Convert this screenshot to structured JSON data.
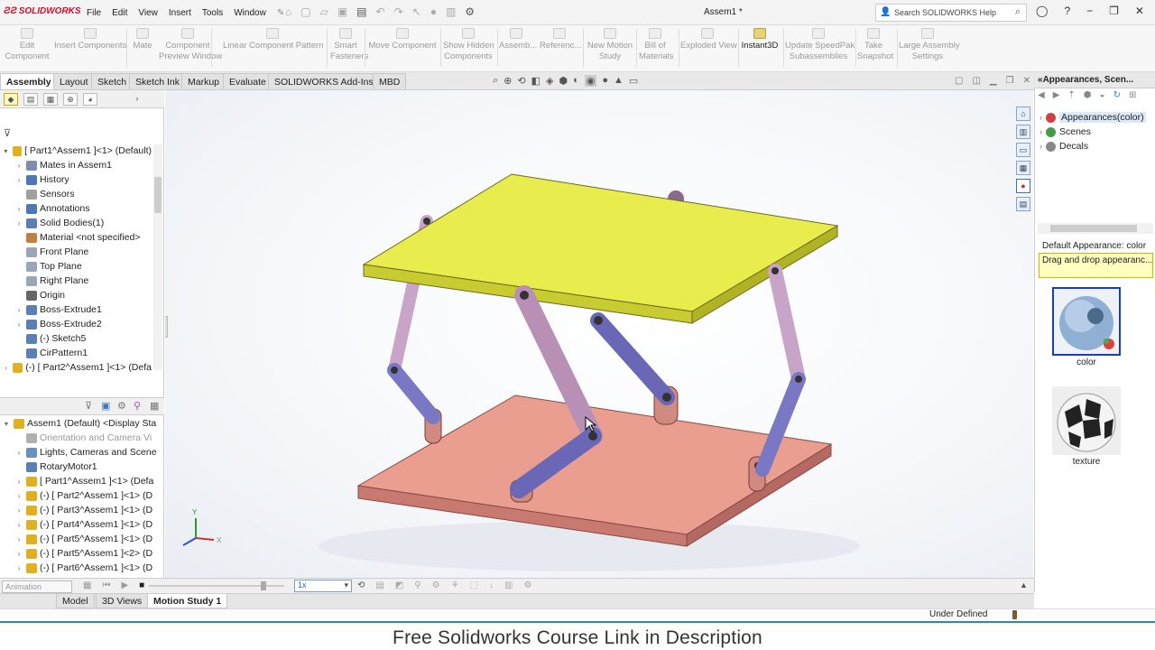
{
  "app": {
    "logo": "SOLIDWORKS",
    "title": "Assem1 *"
  },
  "menu": [
    "File",
    "Edit",
    "View",
    "Insert",
    "Tools",
    "Window"
  ],
  "search": {
    "placeholder": "Search SOLIDWORKS Help"
  },
  "ribbon": [
    {
      "label": "Edit\nComponent",
      "active": false
    },
    {
      "label": "Insert Components",
      "active": false
    },
    {
      "label": "Mate",
      "active": false
    },
    {
      "label": "Component\nPreview Window",
      "active": false
    },
    {
      "label": "Linear Component Pattern",
      "active": false
    },
    {
      "label": "Smart\nFasteners",
      "active": false
    },
    {
      "label": "Move Component",
      "active": false
    },
    {
      "label": "Show Hidden\nComponents",
      "active": false
    },
    {
      "label": "Assemb...",
      "active": false
    },
    {
      "label": "Referenc...",
      "active": false
    },
    {
      "label": "New Motion\nStudy",
      "active": false
    },
    {
      "label": "Bill of\nMaterials",
      "active": false
    },
    {
      "label": "Exploded View",
      "active": false
    },
    {
      "label": "Instant3D",
      "active": true
    },
    {
      "label": "Update SpeedPak\nSubassemblies",
      "active": false
    },
    {
      "label": "Take\nSnapshot",
      "active": false
    },
    {
      "label": "Large Assembly\nSettings",
      "active": false
    }
  ],
  "tabs": [
    "Assembly",
    "Layout",
    "Sketch",
    "Sketch Ink",
    "Markup",
    "Evaluate",
    "SOLIDWORKS Add-Ins",
    "MBD"
  ],
  "tree_top": [
    {
      "label": "[ Part1^Assem1 ]<1> (Default)",
      "indent": 0,
      "tw": "▾",
      "color": "#e0b020"
    },
    {
      "label": "Mates in Assem1",
      "indent": 1,
      "tw": "›",
      "color": "#7a8fb0"
    },
    {
      "label": "History",
      "indent": 1,
      "tw": "›",
      "color": "#4a78b8"
    },
    {
      "label": "Sensors",
      "indent": 1,
      "tw": "",
      "color": "#a0a0a0"
    },
    {
      "label": "Annotations",
      "indent": 1,
      "tw": "›",
      "color": "#4a78b8"
    },
    {
      "label": "Solid Bodies(1)",
      "indent": 1,
      "tw": "›",
      "color": "#5a7fb6"
    },
    {
      "label": "Material <not specified>",
      "indent": 1,
      "tw": "",
      "color": "#c08040"
    },
    {
      "label": "Front Plane",
      "indent": 1,
      "tw": "",
      "color": "#9aa6b8"
    },
    {
      "label": "Top Plane",
      "indent": 1,
      "tw": "",
      "color": "#9aa6b8"
    },
    {
      "label": "Right Plane",
      "indent": 1,
      "tw": "",
      "color": "#9aa6b8"
    },
    {
      "label": "Origin",
      "indent": 1,
      "tw": "",
      "color": "#666666"
    },
    {
      "label": "Boss-Extrude1",
      "indent": 1,
      "tw": "›",
      "color": "#5a7fb6"
    },
    {
      "label": "Boss-Extrude2",
      "indent": 1,
      "tw": "›",
      "color": "#5a7fb6"
    },
    {
      "label": "(-) Sketch5",
      "indent": 1,
      "tw": "",
      "color": "#5a7fb6"
    },
    {
      "label": "CirPattern1",
      "indent": 1,
      "tw": "",
      "color": "#5a7fb6"
    },
    {
      "label": "(-) [ Part2^Assem1 ]<1> (Defa",
      "indent": 0,
      "tw": "›",
      "color": "#e0b020"
    }
  ],
  "tree_bottom": [
    {
      "label": "Assem1 (Default) <Display Sta",
      "indent": 0,
      "tw": "▾",
      "color": "#e0b020",
      "muted": false
    },
    {
      "label": "Orientation and Camera Vi",
      "indent": 1,
      "tw": "",
      "color": "#b0b0b0",
      "muted": true
    },
    {
      "label": "Lights, Cameras and Scene",
      "indent": 1,
      "tw": "›",
      "color": "#6a90c0",
      "muted": false
    },
    {
      "label": "RotaryMotor1",
      "indent": 1,
      "tw": "",
      "color": "#5a7fb6",
      "muted": false
    },
    {
      "label": "[ Part1^Assem1 ]<1> (Defa",
      "indent": 1,
      "tw": "›",
      "color": "#e0b020",
      "muted": false
    },
    {
      "label": "(-) [ Part2^Assem1 ]<1> (D",
      "indent": 1,
      "tw": "›",
      "color": "#e0b020",
      "muted": false
    },
    {
      "label": "(-) [ Part3^Assem1 ]<1> (D",
      "indent": 1,
      "tw": "›",
      "color": "#e0b020",
      "muted": false
    },
    {
      "label": "(-) [ Part4^Assem1 ]<1> (D",
      "indent": 1,
      "tw": "›",
      "color": "#e0b020",
      "muted": false
    },
    {
      "label": "(-) [ Part5^Assem1 ]<1> (D",
      "indent": 1,
      "tw": "›",
      "color": "#e0b020",
      "muted": false
    },
    {
      "label": "(-) [ Part5^Assem1 ]<2> (D",
      "indent": 1,
      "tw": "›",
      "color": "#e0b020",
      "muted": false
    },
    {
      "label": "(-) [ Part6^Assem1 ]<1> (D",
      "indent": 1,
      "tw": "›",
      "color": "#e0b020",
      "muted": false
    }
  ],
  "right_pane": {
    "title": "Appearances, Scen...",
    "items": [
      {
        "label": "Appearances(color)",
        "color": "#d04040",
        "selected": true
      },
      {
        "label": "Scenes",
        "color": "#4a9a4a",
        "selected": false
      },
      {
        "label": "Decals",
        "color": "#888888",
        "selected": false
      }
    ],
    "default_label": "Default Appearance: color",
    "hint": "Drag and drop appearanc...",
    "thumbs": [
      {
        "label": "color"
      },
      {
        "label": "texture"
      }
    ]
  },
  "motion": {
    "mode": "Animation",
    "speed": "1x",
    "tabs": [
      "Model",
      "3D Views",
      "Motion Study 1"
    ],
    "active_tab": "Motion Study 1"
  },
  "status": "Under Defined",
  "banner": "Free Solidworks Course Link in Description",
  "colors": {
    "top_plate": "#e6ea4a",
    "bottom_plate": "#e69a8c",
    "link_blue": "#7a78c4",
    "link_pink": "#c8a4c8",
    "accent": "#2a8f9b"
  }
}
